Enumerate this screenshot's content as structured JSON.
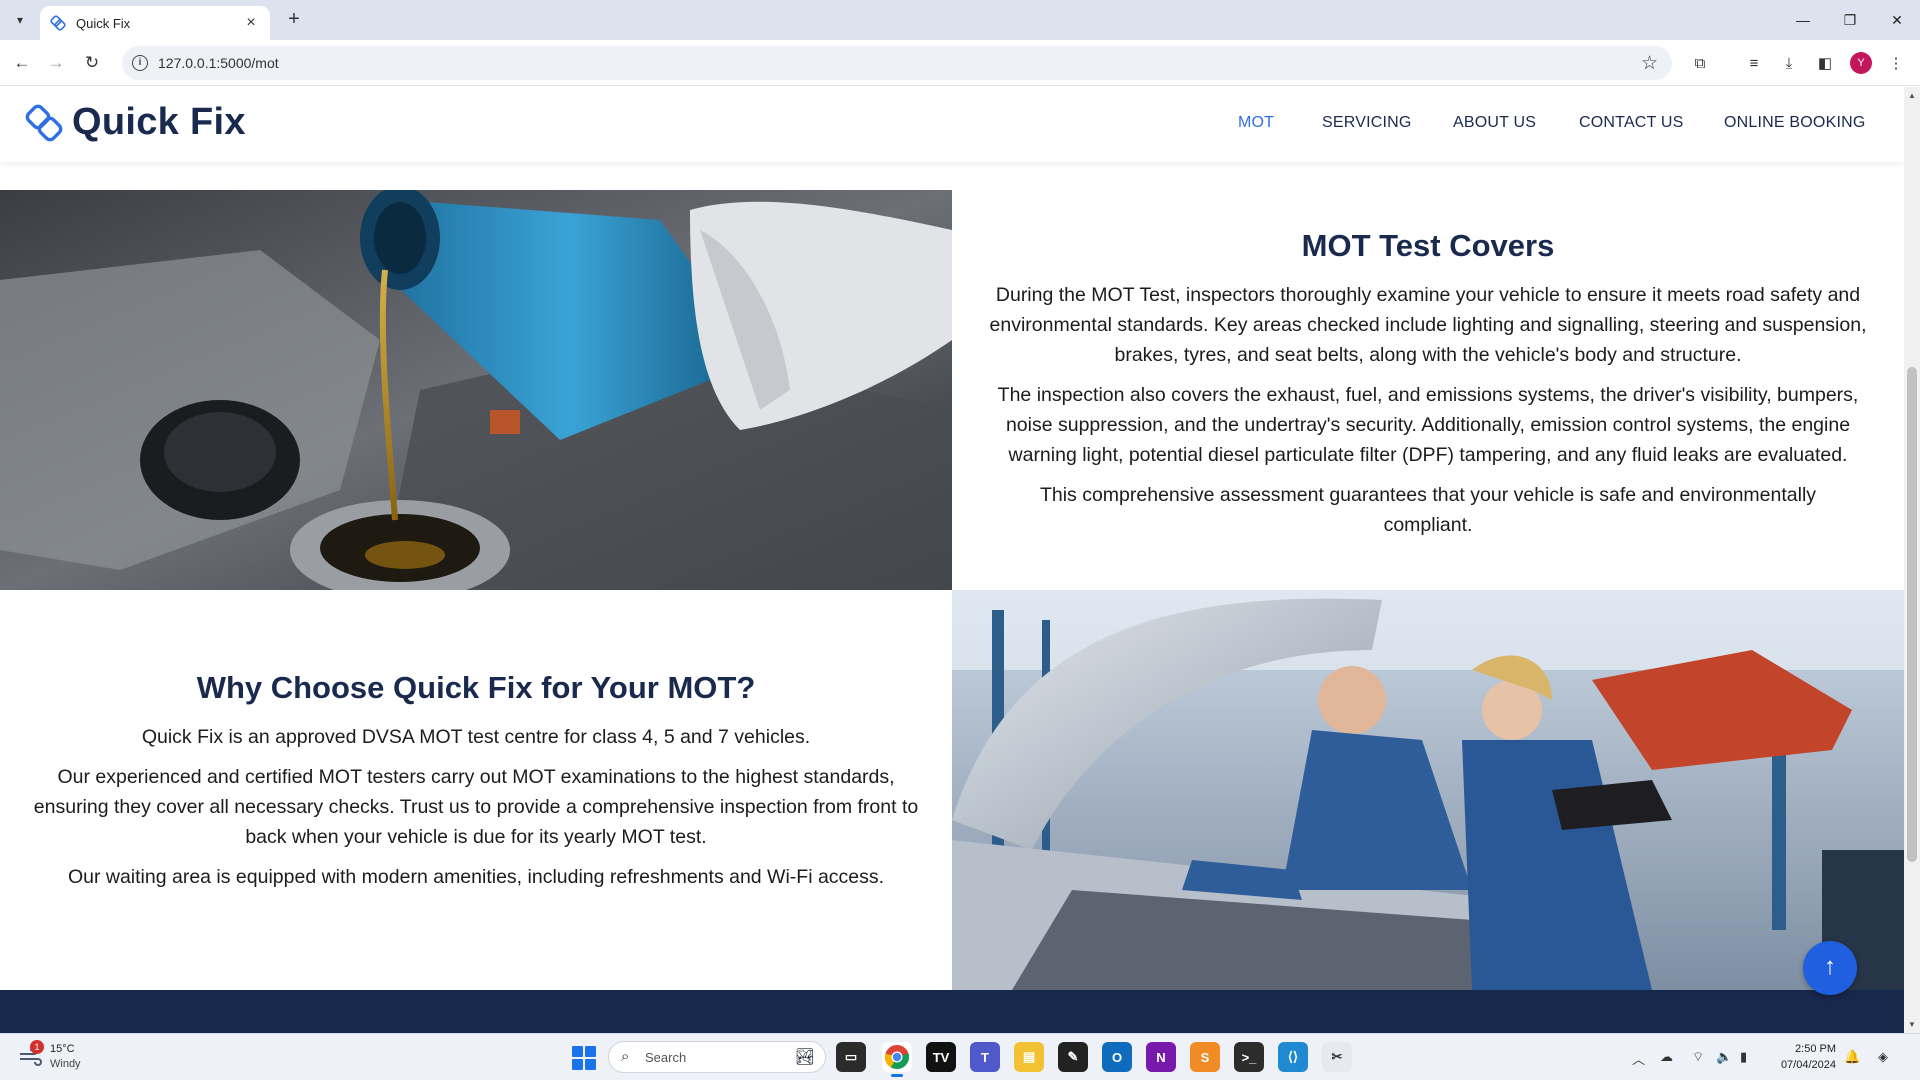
{
  "browser": {
    "tab_title": "Quick Fix",
    "url": "127.0.0.1:5000/mot",
    "profile_initial": "Y"
  },
  "header": {
    "brand": "Quick Fix",
    "nav": [
      {
        "label": "MOT",
        "active": true
      },
      {
        "label": "SERVICING"
      },
      {
        "label": "ABOUT US"
      },
      {
        "label": "CONTACT US"
      },
      {
        "label": "ONLINE BOOKING"
      }
    ]
  },
  "covers": {
    "title": "MOT Test Covers",
    "paragraphs": [
      "During the MOT Test, inspectors thoroughly examine your vehicle to ensure it meets road safety and environmental standards. Key areas checked include lighting and signalling, steering and suspension, brakes, tyres, and seat belts, along with the vehicle's body and structure.",
      "The inspection also covers the exhaust, fuel, and emissions systems, the driver's visibility, bumpers, noise suppression, and the undertray's security. Additionally, emission control systems, the engine warning light, potential diesel particulate filter (DPF) tampering, and any fluid leaks are evaluated.",
      "This comprehensive assessment guarantees that your vehicle is safe and environmentally compliant."
    ]
  },
  "why": {
    "title": "Why Choose Quick Fix for Your MOT?",
    "paragraphs": [
      "Quick Fix is an approved DVSA MOT test centre for class 4, 5 and 7 vehicles.",
      "Our experienced and certified MOT testers carry out MOT examinations to the highest standards, ensuring they cover all necessary checks. Trust us to provide a comprehensive inspection from front to back when your vehicle is due for its yearly MOT test.",
      "Our waiting area is equipped with modern amenities, including refreshments and Wi-Fi access."
    ]
  },
  "back_to_top_icon": "arrow-up-icon",
  "taskbar": {
    "weather_badge": "1",
    "weather_temp": "15°C",
    "weather_desc": "Windy",
    "search_placeholder": "Search",
    "time": "2:50 PM",
    "date": "07/04/2024"
  },
  "colors": {
    "brand_navy": "#1a2a4f",
    "nav_active": "#2f6fe4",
    "footer": "#17284d",
    "back_to_top": "#1f5fe0"
  }
}
